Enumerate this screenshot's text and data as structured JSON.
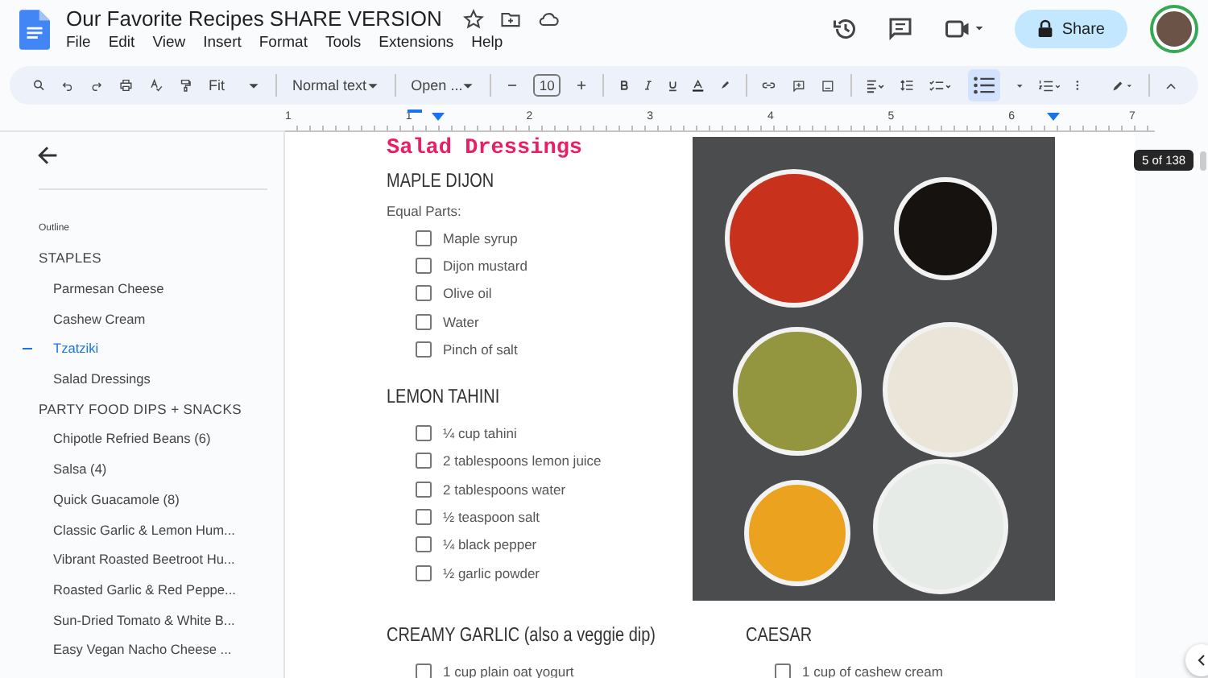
{
  "document": {
    "title": "Our Favorite Recipes SHARE VERSION"
  },
  "menu": [
    "File",
    "Edit",
    "View",
    "Insert",
    "Format",
    "Tools",
    "Extensions",
    "Help"
  ],
  "share_button": "Share",
  "toolbar": {
    "zoom": "Fit",
    "style": "Normal text",
    "font": "Open ...",
    "font_size": "10",
    "bulleted_list_selected": true
  },
  "ruler": [
    "1",
    "1",
    "2",
    "3",
    "4",
    "5",
    "6",
    "7"
  ],
  "outline": {
    "label": "Outline",
    "items": [
      {
        "label": "STAPLES",
        "selected": false,
        "children": [
          {
            "label": "Parmesan Cheese",
            "selected": false
          },
          {
            "label": "Cashew Cream",
            "selected": false
          },
          {
            "label": "Tzatziki",
            "selected": true
          },
          {
            "label": "Salad Dressings",
            "selected": false
          }
        ]
      },
      {
        "label": "PARTY FOOD DIPS + SNACKS",
        "selected": false,
        "children": [
          {
            "label": "Chipotle Refried Beans (6)",
            "selected": false
          },
          {
            "label": "Salsa (4)",
            "selected": false
          },
          {
            "label": "Quick Guacamole (8)",
            "selected": false
          },
          {
            "label": "Classic Garlic & Lemon Hum...",
            "selected": false
          },
          {
            "label": "Vibrant Roasted Beetroot Hu...",
            "selected": false
          },
          {
            "label": "Roasted Garlic & Red Peppe...",
            "selected": false
          },
          {
            "label": "Sun-Dried Tomato & White B...",
            "selected": false
          },
          {
            "label": "Easy Vegan Nacho Cheese ...",
            "selected": false
          }
        ]
      }
    ]
  },
  "page": {
    "heading": "Salad Dressings",
    "page_counter": "5 of 138",
    "recipes": [
      {
        "title": "MAPLE DIJON",
        "note": "Equal Parts:",
        "items": [
          {
            "text": "Maple syrup",
            "checked": false
          },
          {
            "text": "Dijon mustard",
            "checked": false
          },
          {
            "text": "Olive oil",
            "checked": false
          },
          {
            "text": "Water",
            "checked": false
          },
          {
            "text": "Pinch of salt",
            "checked": false
          }
        ]
      },
      {
        "title": "LEMON TAHINI",
        "items": [
          {
            "text": "¼ cup tahini",
            "checked": false
          },
          {
            "text": "2 tablespoons lemon juice",
            "checked": false
          },
          {
            "text": "2 tablespoons water",
            "checked": false
          },
          {
            "text": "½ teaspoon salt",
            "checked": false
          },
          {
            "text": "¼ black pepper",
            "checked": false
          },
          {
            "text": "½ garlic powder",
            "checked": false
          }
        ]
      },
      {
        "title": "CREAMY GARLIC (also a veggie dip)",
        "items": [
          {
            "text": "1 cup plain oat yogurt",
            "checked": false
          }
        ]
      },
      {
        "title": "CAESAR",
        "items": [
          {
            "text": "1 cup of cashew cream",
            "checked": false
          }
        ]
      }
    ]
  }
}
